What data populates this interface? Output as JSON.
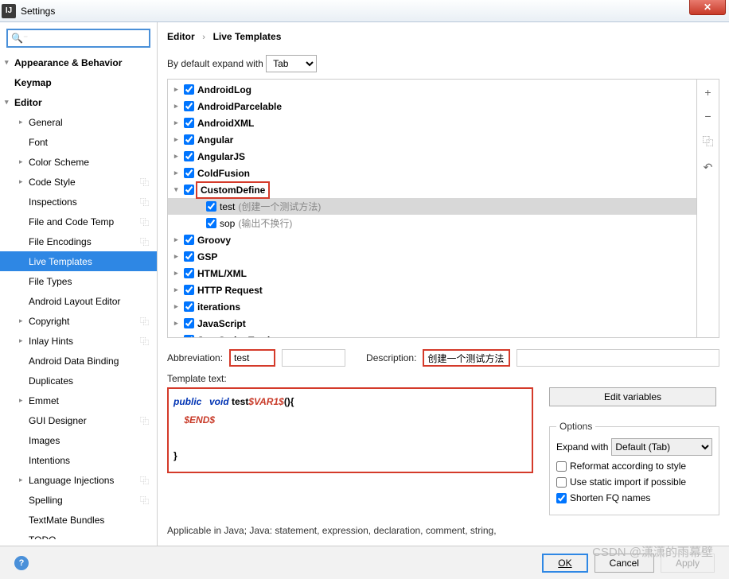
{
  "window": {
    "title": "Settings",
    "close": "✕"
  },
  "breadcrumb": {
    "a": "Editor",
    "b": "Live Templates"
  },
  "expand": {
    "label": "By default expand with",
    "value": "Tab"
  },
  "sidebar": {
    "items": [
      {
        "label": "Appearance & Behavior",
        "depth": 1,
        "arrow": "▾",
        "bold": true
      },
      {
        "label": "Keymap",
        "depth": 1,
        "bold": true
      },
      {
        "label": "Editor",
        "depth": 1,
        "arrow": "▾",
        "bold": true
      },
      {
        "label": "General",
        "depth": 2,
        "arrow": "▸"
      },
      {
        "label": "Font",
        "depth": 2
      },
      {
        "label": "Color Scheme",
        "depth": 2,
        "arrow": "▸"
      },
      {
        "label": "Code Style",
        "depth": 2,
        "arrow": "▸",
        "copy": true
      },
      {
        "label": "Inspections",
        "depth": 2,
        "copy": true
      },
      {
        "label": "File and Code Temp",
        "depth": 2,
        "copy": true
      },
      {
        "label": "File Encodings",
        "depth": 2,
        "copy": true
      },
      {
        "label": "Live Templates",
        "depth": 2,
        "selected": true
      },
      {
        "label": "File Types",
        "depth": 2
      },
      {
        "label": "Android Layout Editor",
        "depth": 2
      },
      {
        "label": "Copyright",
        "depth": 2,
        "arrow": "▸",
        "copy": true
      },
      {
        "label": "Inlay Hints",
        "depth": 2,
        "arrow": "▸",
        "copy": true
      },
      {
        "label": "Android Data Binding",
        "depth": 2
      },
      {
        "label": "Duplicates",
        "depth": 2
      },
      {
        "label": "Emmet",
        "depth": 2,
        "arrow": "▸"
      },
      {
        "label": "GUI Designer",
        "depth": 2,
        "copy": true
      },
      {
        "label": "Images",
        "depth": 2
      },
      {
        "label": "Intentions",
        "depth": 2
      },
      {
        "label": "Language Injections",
        "depth": 2,
        "arrow": "▸",
        "copy": true
      },
      {
        "label": "Spelling",
        "depth": 2,
        "copy": true
      },
      {
        "label": "TextMate Bundles",
        "depth": 2
      },
      {
        "label": "TODO",
        "depth": 2
      }
    ]
  },
  "groups": [
    {
      "name": "AndroidLog"
    },
    {
      "name": "AndroidParcelable"
    },
    {
      "name": "AndroidXML"
    },
    {
      "name": "Angular"
    },
    {
      "name": "AngularJS"
    },
    {
      "name": "ColdFusion"
    },
    {
      "name": "CustomDefine",
      "expanded": true,
      "hl": true,
      "children": [
        {
          "name": "test",
          "desc": "(创建一个测试方法)",
          "sel": true
        },
        {
          "name": "sop",
          "desc": "(输出不换行)"
        }
      ]
    },
    {
      "name": "Groovy"
    },
    {
      "name": "GSP"
    },
    {
      "name": "HTML/XML"
    },
    {
      "name": "HTTP Request"
    },
    {
      "name": "iterations"
    },
    {
      "name": "JavaScript"
    },
    {
      "name": "JavaScript Testing"
    }
  ],
  "form": {
    "abbr_label": "Abbreviation:",
    "abbr_value": "test",
    "desc_label": "Description:",
    "desc_value": "创建一个测试方法",
    "template_label": "Template text:",
    "edit_vars": "Edit variables"
  },
  "template": {
    "l1a": "public",
    "l1b": "void",
    "l1c": " test",
    "l1d": "$VAR1$",
    "l1e": "(){",
    "l2a": "    ",
    "l2b": "$END$",
    "l3": "}"
  },
  "options": {
    "title": "Options",
    "expand_label": "Expand with",
    "expand_value": "Default (Tab)",
    "reformat": "Reformat according to style",
    "static_import": "Use static import if possible",
    "shorten": "Shorten FQ names"
  },
  "applicable": "Applicable in Java; Java: statement, expression, declaration, comment, string,",
  "footer": {
    "ok": "OK",
    "cancel": "Cancel",
    "apply": "Apply"
  },
  "watermark": "CSDN @潇潇的雨幕壁"
}
